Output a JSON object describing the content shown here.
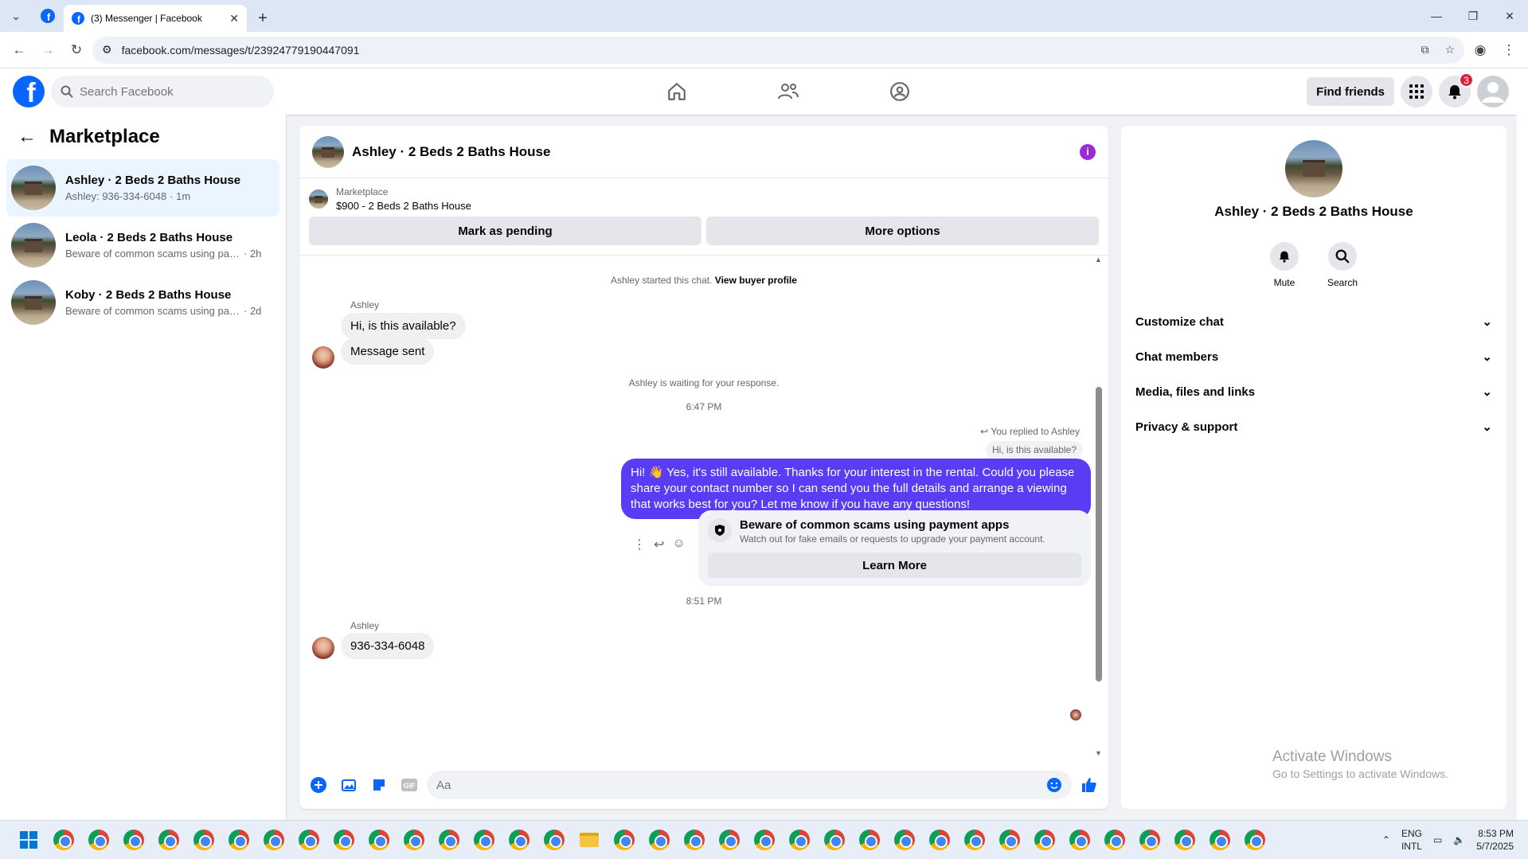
{
  "browser": {
    "tab_title": "(3) Messenger | Facebook",
    "url": "facebook.com/messages/t/23924779190447091"
  },
  "header": {
    "search_placeholder": "Search Facebook",
    "find_friends": "Find friends",
    "notification_count": "3"
  },
  "left": {
    "title": "Marketplace",
    "conversations": [
      {
        "name": "Ashley · 2 Beds 2 Baths House",
        "preview": "Ashley: 936-334-6048",
        "time": "· 1m"
      },
      {
        "name": "Leola · 2 Beds 2 Baths House",
        "preview": "Beware of common scams using pay...",
        "time": "· 2h"
      },
      {
        "name": "Koby · 2 Beds 2 Baths House",
        "preview": "Beware of common scams using pay...",
        "time": "· 2d"
      }
    ]
  },
  "chat": {
    "title": "Ashley · 2 Beds 2 Baths House",
    "listing_label": "Marketplace",
    "listing_desc": "$900 - 2 Beds 2 Baths House",
    "mark_pending": "Mark as pending",
    "more_options": "More options",
    "started_note": "Ashley started this chat.",
    "view_buyer": "View buyer profile",
    "sender_name": "Ashley",
    "msg1": "Hi, is this available?",
    "msg2": "Message sent",
    "waiting_note": "Ashley is waiting for your response.",
    "time1": "6:47 PM",
    "replied_to": "You replied to Ashley",
    "quoted": "Hi, is this available?",
    "outgoing": "Hi! 👋 Yes, it's still available. Thanks for your interest in the rental. Could you please share your contact number so I can send you the full details and arrange a viewing that works best for you? Let me know if you have any questions!",
    "scam_title": "Beware of common scams using payment apps",
    "scam_sub": "Watch out for fake emails or requests to upgrade your payment account.",
    "learn_more": "Learn More",
    "time2": "8:51 PM",
    "sender_name2": "Ashley",
    "msg3": "936-334-6048",
    "composer_placeholder": "Aa"
  },
  "right": {
    "name": "Ashley · 2 Beds 2 Baths House",
    "mute": "Mute",
    "search": "Search",
    "menu": [
      "Customize chat",
      "Chat members",
      "Media, files and links",
      "Privacy & support"
    ]
  },
  "watermark": {
    "line1": "Activate Windows",
    "line2": "Go to Settings to activate Windows."
  },
  "taskbar": {
    "lang1": "ENG",
    "lang2": "INTL",
    "time": "8:53 PM",
    "date": "5/7/2025"
  },
  "colors": {
    "fb_blue": "#0866ff",
    "messenger_purple": "#5b3cf5",
    "active_row": "#ebf5ff"
  }
}
